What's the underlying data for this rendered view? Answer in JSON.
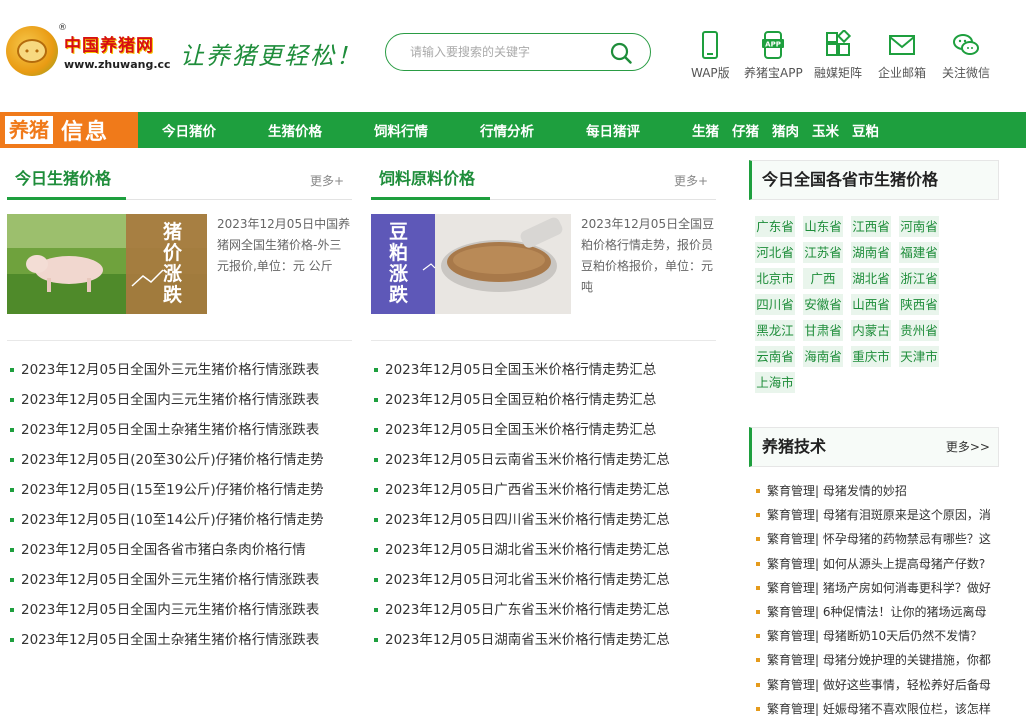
{
  "logo": {
    "cn": "中国养猪网",
    "url": "www.zhuwang.cc",
    "reg": "®"
  },
  "slogan": "让养猪更轻松！",
  "search": {
    "placeholder": "请输入要搜索的关键字"
  },
  "quick_links": [
    {
      "label": "WAP版",
      "icon": "phone-icon"
    },
    {
      "label": "养猪宝APP",
      "icon": "app-icon"
    },
    {
      "label": "融媒矩阵",
      "icon": "matrix-icon"
    },
    {
      "label": "企业邮箱",
      "icon": "mail-icon"
    },
    {
      "label": "关注微信",
      "icon": "wechat-icon"
    }
  ],
  "nav": {
    "brand_a": "养猪",
    "brand_b": "信息",
    "items": [
      "今日猪价",
      "生猪价格",
      "饲料行情",
      "行情分析",
      "每日猪评"
    ],
    "tags": [
      "生猪",
      "仔猪",
      "猪肉",
      "玉米",
      "豆粕"
    ]
  },
  "col1": {
    "title": "今日生猪价格",
    "more": "更多+",
    "feature_img_text": "猪价涨跌",
    "feature_text": "2023年12月05日中国养猪网全国生猪价格-外三元报价,单位：元 公斤",
    "items": [
      "2023年12月05日全国外三元生猪价格行情涨跌表",
      "2023年12月05日全国内三元生猪价格行情涨跌表",
      "2023年12月05日全国土杂猪生猪价格行情涨跌表",
      "2023年12月05日(20至30公斤)仔猪价格行情走势",
      "2023年12月05日(15至19公斤)仔猪价格行情走势",
      "2023年12月05日(10至14公斤)仔猪价格行情走势",
      "2023年12月05日全国各省市猪白条肉价格行情",
      "2023年12月05日全国外三元生猪价格行情涨跌表",
      "2023年12月05日全国内三元生猪价格行情涨跌表",
      "2023年12月05日全国土杂猪生猪价格行情涨跌表"
    ]
  },
  "col2": {
    "title": "饲料原料价格",
    "more": "更多+",
    "feature_img_text": "豆粕涨跌",
    "feature_text": "2023年12月05日全国豆粕价格行情走势，报价员豆粕价格报价，单位：元吨",
    "items": [
      "2023年12月05日全国玉米价格行情走势汇总",
      "2023年12月05日全国豆粕价格行情走势汇总",
      "2023年12月05日全国玉米价格行情走势汇总",
      "2023年12月05日云南省玉米价格行情走势汇总",
      "2023年12月05日广西省玉米价格行情走势汇总",
      "2023年12月05日四川省玉米价格行情走势汇总",
      "2023年12月05日湖北省玉米价格行情走势汇总",
      "2023年12月05日河北省玉米价格行情走势汇总",
      "2023年12月05日广东省玉米价格行情走势汇总",
      "2023年12月05日湖南省玉米价格行情走势汇总"
    ]
  },
  "provinces": {
    "title": "今日全国各省市生猪价格",
    "items": [
      "广东省",
      "山东省",
      "江西省",
      "河南省",
      "河北省",
      "江苏省",
      "湖南省",
      "福建省",
      "北京市",
      "广西",
      "湖北省",
      "浙江省",
      "四川省",
      "安徽省",
      "山西省",
      "陕西省",
      "黑龙江",
      "甘肃省",
      "内蒙古",
      "贵州省",
      "云南省",
      "海南省",
      "重庆市",
      "天津市",
      "上海市"
    ]
  },
  "tech": {
    "title": "养猪技术",
    "more": "更多>>",
    "items": [
      {
        "cat": "繁育管理",
        "text": "母猪发情的妙招"
      },
      {
        "cat": "繁育管理",
        "text": "母猪有泪斑原来是这个原因，消"
      },
      {
        "cat": "繁育管理",
        "text": "怀孕母猪的药物禁忌有哪些？这"
      },
      {
        "cat": "繁育管理",
        "text": "如何从源头上提高母猪产仔数?"
      },
      {
        "cat": "繁育管理",
        "text": "猪场产房如何消毒更科学？做好"
      },
      {
        "cat": "繁育管理",
        "text": "6种促情法！让你的猪场远离母"
      },
      {
        "cat": "繁育管理",
        "text": "母猪断奶10天后仍然不发情？"
      },
      {
        "cat": "繁育管理",
        "text": "母猪分娩护理的关键措施，你都"
      },
      {
        "cat": "繁育管理",
        "text": "做好这些事情，轻松养好后备母"
      },
      {
        "cat": "繁育管理",
        "text": "妊娠母猪不喜欢限位栏，该怎样"
      }
    ]
  }
}
